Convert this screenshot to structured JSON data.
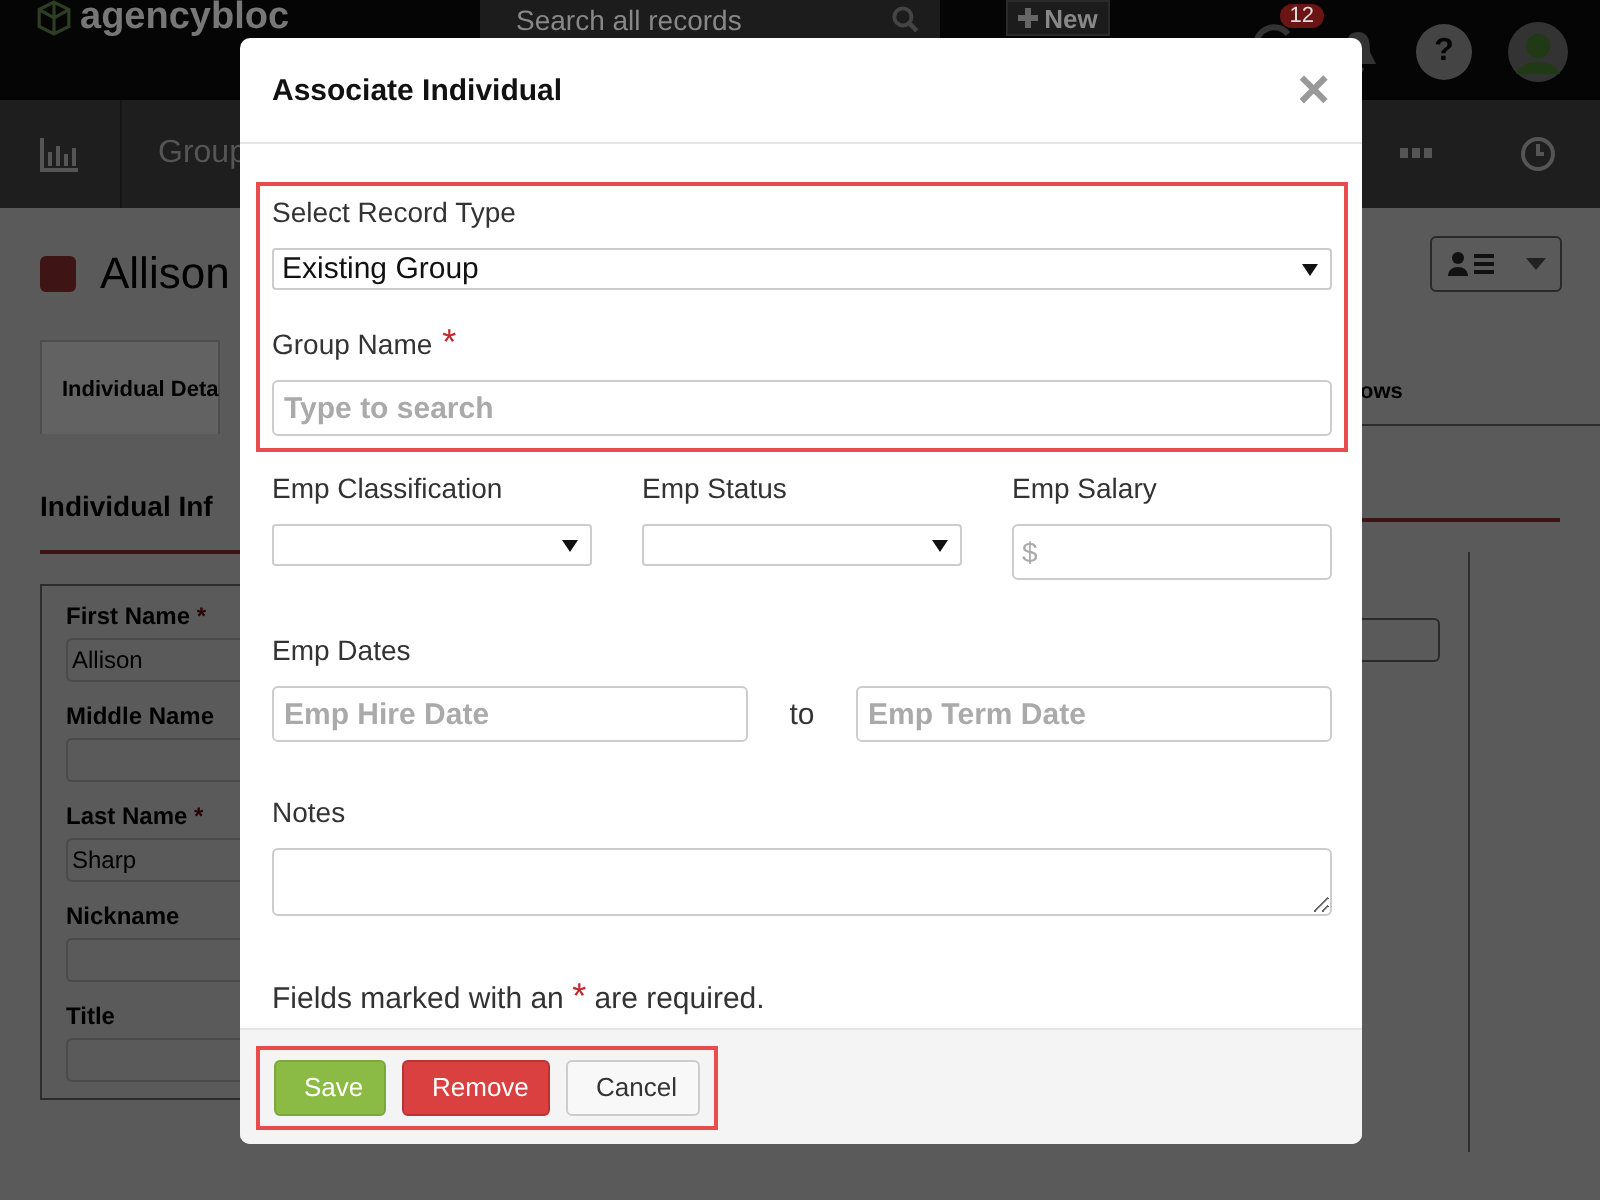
{
  "header": {
    "logo": "agencybloc",
    "search": {
      "placeholder": "Search all records"
    },
    "new_button": "New",
    "notification_count": "12",
    "help": "?"
  },
  "nav": {
    "items": [
      "Group"
    ]
  },
  "record": {
    "title": "Allison",
    "tabs": [
      {
        "label": "Individual Deta",
        "selected": true
      },
      {
        "label": "ows",
        "selected": false
      }
    ],
    "section_title": "Individual Inf",
    "fields": [
      {
        "label": "First Name",
        "required": true,
        "value": "Allison"
      },
      {
        "label": "Middle Name",
        "required": false
      },
      {
        "label": "Last Name",
        "required": true,
        "value": "Sharp"
      },
      {
        "label": "Nickname",
        "required": false
      },
      {
        "label": "Title",
        "required": false
      }
    ]
  },
  "modal": {
    "title": "Associate Individual",
    "close": "×",
    "record_type": {
      "label": "Select Record Type",
      "value": "Existing Group"
    },
    "group_name": {
      "label": "Group Name",
      "required": true,
      "placeholder": "Type to search"
    },
    "employment": [
      {
        "label": "Emp Classification",
        "kind": "select"
      },
      {
        "label": "Emp Status",
        "kind": "select"
      },
      {
        "label": "Emp Salary",
        "kind": "currency",
        "prefix": "$"
      }
    ],
    "dates": {
      "label": "Emp Dates",
      "start_placeholder": "Emp Hire Date",
      "separator": "to",
      "end_placeholder": "Emp Term Date"
    },
    "notes": {
      "label": "Notes"
    },
    "required_note": {
      "before": "Fields marked with an",
      "mark": "*",
      "after": "are required."
    },
    "buttons": [
      {
        "label": "Save",
        "kind": "success"
      },
      {
        "label": "Remove",
        "kind": "danger"
      },
      {
        "label": "Cancel",
        "kind": "default"
      }
    ]
  }
}
